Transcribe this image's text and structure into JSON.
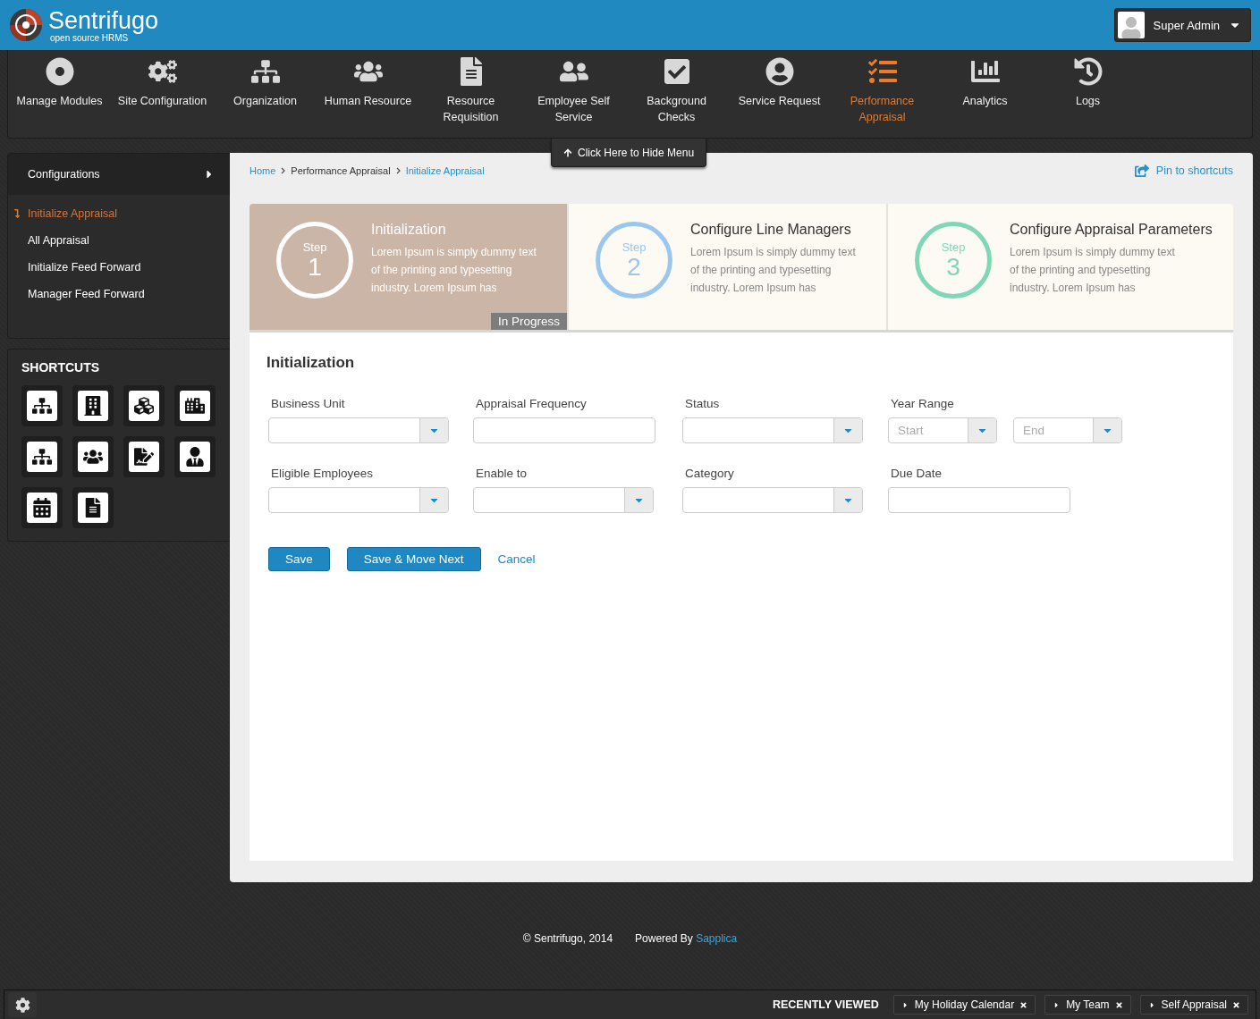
{
  "header": {
    "logo": {
      "name": "Sentrifugo",
      "tagline": "open source HRMS"
    },
    "user": {
      "name": "Super Admin"
    }
  },
  "nav": {
    "items": [
      {
        "label": "Manage Modules",
        "selected": false
      },
      {
        "label": "Site Configuration",
        "selected": false
      },
      {
        "label": "Organization",
        "selected": false
      },
      {
        "label": "Human Resource",
        "selected": false
      },
      {
        "label": "Resource Requisition",
        "selected": false
      },
      {
        "label": "Employee Self Service",
        "selected": false
      },
      {
        "label": "Background Checks",
        "selected": false
      },
      {
        "label": "Service Request",
        "selected": false
      },
      {
        "label": "Performance Appraisal",
        "selected": true
      },
      {
        "label": "Analytics",
        "selected": false
      },
      {
        "label": "Logs",
        "selected": false
      }
    ],
    "hide_menu": "Click Here to Hide Menu"
  },
  "sidebar": {
    "section": "Configurations",
    "items": [
      {
        "label": "Initialize Appraisal",
        "selected": true
      },
      {
        "label": "All Appraisal",
        "selected": false
      },
      {
        "label": "Initialize Feed Forward",
        "selected": false
      },
      {
        "label": "Manager  Feed Forward",
        "selected": false
      }
    ],
    "shortcuts": {
      "title": "SHORTCUTS"
    }
  },
  "breadcrumb": [
    "Home",
    "Performance Appraisal",
    "Initialize Appraisal"
  ],
  "pin": "Pin to shortcuts",
  "steps": [
    {
      "step_label": "Step",
      "number": "1",
      "title": "Initialization",
      "description": "Lorem Ipsum is simply dummy text of the printing and typesetting industry. Lorem Ipsum has",
      "selected": true,
      "status": "In Progress",
      "color": "#ffffff"
    },
    {
      "step_label": "Step",
      "number": "2",
      "title": "Configure Line Managers",
      "description": "Lorem Ipsum is simply dummy text of the printing and typesetting industry. Lorem Ipsum has",
      "selected": false,
      "color": "#9cc7ec"
    },
    {
      "step_label": "Step",
      "number": "3",
      "title": "Configure Appraisal Parameters",
      "description": "Lorem Ipsum is simply dummy text of the printing and typesetting industry. Lorem Ipsum has",
      "selected": false,
      "color": "#7fd7b7"
    }
  ],
  "form": {
    "title": "Initialization",
    "fields": [
      {
        "label": "Business Unit",
        "kind": "select"
      },
      {
        "label": "Appraisal Frequency",
        "kind": "text"
      },
      {
        "label": "Status",
        "kind": "select"
      },
      {
        "label": "Year Range",
        "kind": "range",
        "parts": [
          {
            "placeholder": "Start"
          },
          {
            "placeholder": "End"
          }
        ]
      },
      {
        "label": "Eligible Employees",
        "kind": "select"
      },
      {
        "label": "Enable to",
        "kind": "select"
      },
      {
        "label": "Category",
        "kind": "select"
      },
      {
        "label": "Due Date",
        "kind": "text"
      }
    ],
    "buttons": [
      {
        "label": "Save",
        "kind": "primary"
      },
      {
        "label": "Save & Move Next",
        "kind": "primary"
      },
      {
        "label": "Cancel",
        "kind": "link"
      }
    ]
  },
  "footer": {
    "copyright": "© Sentrifugo, 2014",
    "powered_by": "Powered By",
    "link": "Sapplica"
  },
  "recent": {
    "title": "RECENTLY VIEWED",
    "items": [
      "My Holiday Calendar",
      "My Team",
      "Self Appraisal"
    ]
  }
}
